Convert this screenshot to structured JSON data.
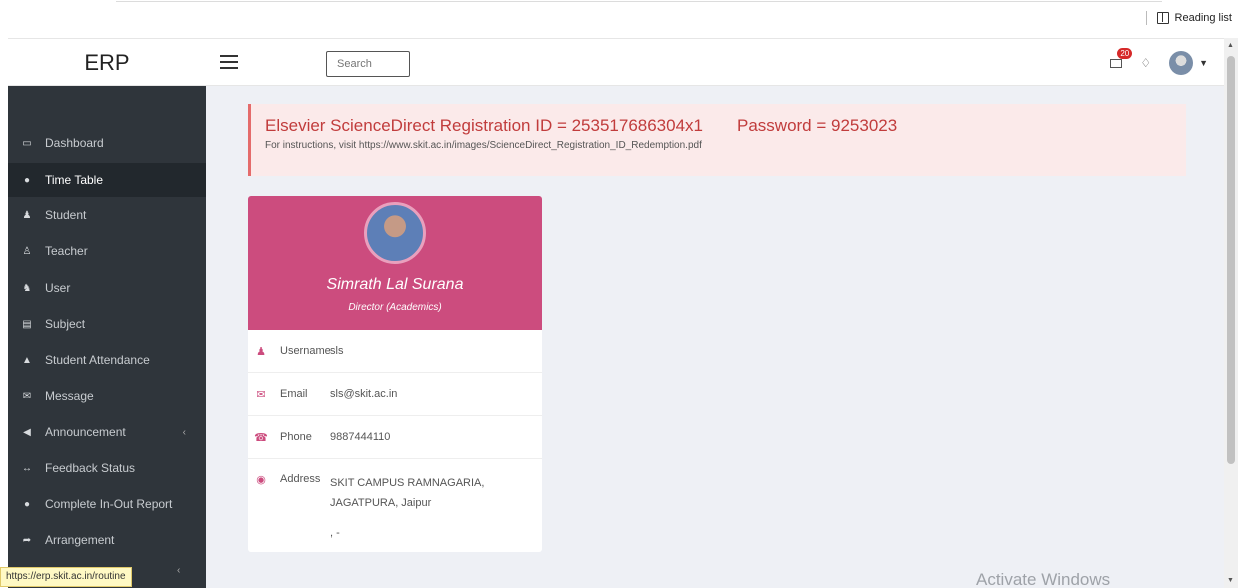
{
  "browser": {
    "reading_list_label": "Reading list"
  },
  "topnav": {
    "brand": "ERP",
    "search_placeholder": "Search",
    "mail_badge": "20"
  },
  "sidebar": {
    "items": [
      {
        "label": "Dashboard",
        "icon": "laptop-icon"
      },
      {
        "label": "Time Table",
        "icon": "circle-icon",
        "active": true
      },
      {
        "label": "Student",
        "icon": "user-icon"
      },
      {
        "label": "Teacher",
        "icon": "teacher-icon"
      },
      {
        "label": "User",
        "icon": "users-icon"
      },
      {
        "label": "Subject",
        "icon": "book-icon"
      },
      {
        "label": "Student Attendance",
        "icon": "sitemap-icon"
      },
      {
        "label": "Message",
        "icon": "envelope-icon"
      },
      {
        "label": "Announcement",
        "icon": "bullhorn-icon"
      },
      {
        "label": "Feedback Status",
        "icon": "arrows-icon"
      },
      {
        "label": "Complete In-Out Report",
        "icon": "circle-icon"
      },
      {
        "label": "Arrangement",
        "icon": "share-icon"
      }
    ],
    "status_url": "https://erp.skit.ac.in/routine"
  },
  "alert": {
    "registration": "Elsevier ScienceDirect Registration ID = 253517686304x1",
    "password": "Password = 9253023",
    "instructions": "For instructions, visit https://www.skit.ac.in/images/ScienceDirect_Registration_ID_Redemption.pdf"
  },
  "profile": {
    "name": "Simrath Lal Surana",
    "role": "Director (Academics)",
    "username_label": "Username",
    "username": "sls",
    "email_label": "Email",
    "email": "sls@skit.ac.in",
    "phone_label": "Phone",
    "phone": "9887444110",
    "address_label": "Address",
    "address_line1": "SKIT CAMPUS RAMNAGARIA,",
    "address_line2": "JAGATPURA, Jaipur",
    "address_line3": ", -"
  },
  "watermark": "Activate Windows",
  "colors": {
    "accent": "#cc4c7e",
    "sidebar": "#2f353b",
    "alert_text": "#c13c3c"
  }
}
